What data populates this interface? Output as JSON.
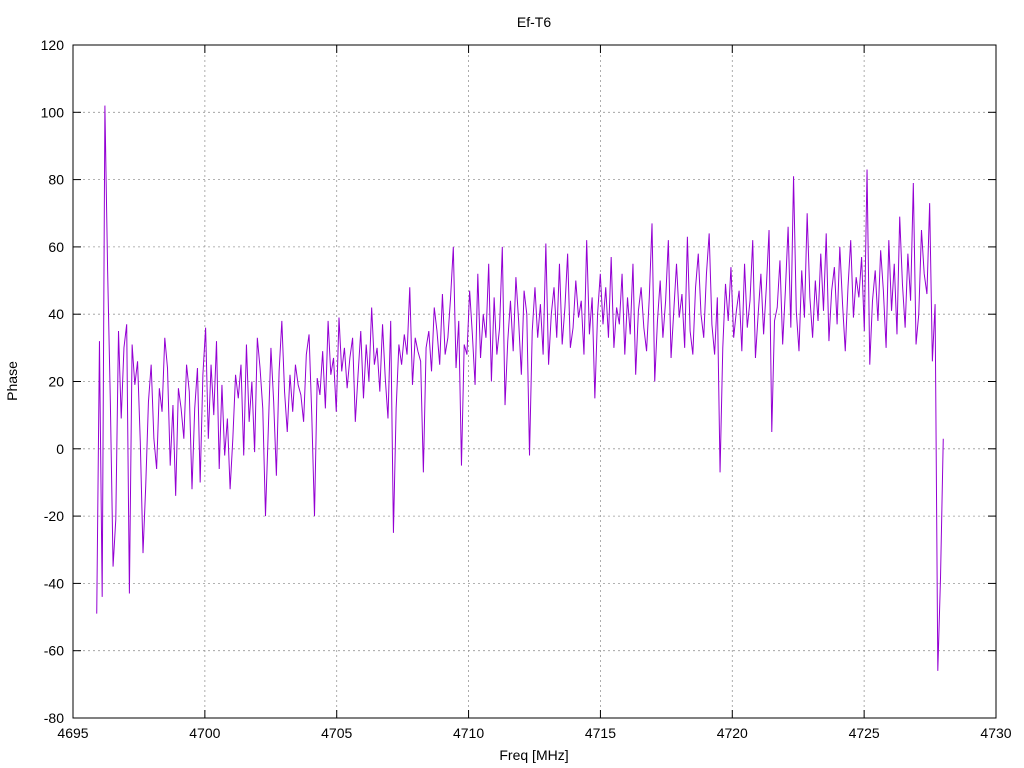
{
  "chart_data": {
    "type": "line",
    "title": "Ef-T6",
    "xlabel": "Freq [MHz]",
    "ylabel": "Phase",
    "xlim": [
      4695,
      4730
    ],
    "ylim": [
      -80,
      120
    ],
    "xticks": [
      4695,
      4700,
      4705,
      4710,
      4715,
      4720,
      4725,
      4730
    ],
    "yticks": [
      -80,
      -60,
      -40,
      -20,
      0,
      20,
      40,
      60,
      80,
      100,
      120
    ],
    "xtick_labels": [
      "4695",
      "4700",
      "4705",
      "4710",
      "4715",
      "4720",
      "4725",
      "4730"
    ],
    "ytick_labels": [
      "-80",
      "-60",
      "-40",
      "-20",
      "0",
      "20",
      "40",
      "60",
      "80",
      "100",
      "120"
    ],
    "grid": true,
    "line_color": "#9400d3",
    "series": [
      {
        "x_start": 4695.9,
        "x_end": 4728.0,
        "values": [
          -49,
          32,
          -44,
          102,
          53,
          14,
          -35,
          -21,
          35,
          9,
          30,
          37,
          -43,
          31,
          19,
          26,
          2,
          -31,
          -11,
          14,
          25,
          3,
          -6,
          18,
          11,
          33,
          24,
          -5,
          13,
          -14,
          18,
          12,
          3,
          25,
          17,
          -12,
          12,
          24,
          -10,
          22,
          36,
          3,
          25,
          10,
          32,
          -6,
          19,
          -2,
          9,
          -12,
          3,
          22,
          15,
          25,
          -2,
          31,
          8,
          20,
          -1,
          33,
          24,
          12,
          -20,
          5,
          30,
          14,
          -8,
          23,
          38,
          17,
          5,
          22,
          11,
          25,
          19,
          16,
          8,
          28,
          34,
          10,
          -20,
          21,
          16,
          29,
          12,
          38,
          22,
          27,
          11,
          39,
          23,
          30,
          18,
          27,
          33,
          8,
          22,
          35,
          15,
          31,
          20,
          42,
          25,
          30,
          17,
          37,
          21,
          9,
          38,
          -25,
          12,
          31,
          25,
          34,
          28,
          48,
          19,
          33,
          29,
          26,
          -7,
          30,
          35,
          23,
          42,
          35,
          25,
          46,
          28,
          33,
          45,
          60,
          24,
          38,
          -5,
          31,
          28,
          47,
          34,
          19,
          52,
          27,
          40,
          33,
          55,
          20,
          45,
          28,
          36,
          60,
          13,
          32,
          44,
          29,
          51,
          38,
          22,
          47,
          40,
          -2,
          35,
          48,
          33,
          43,
          28,
          61,
          25,
          40,
          48,
          33,
          55,
          31,
          42,
          58,
          30,
          36,
          50,
          39,
          44,
          28,
          62,
          34,
          45,
          15,
          40,
          52,
          37,
          48,
          33,
          57,
          30,
          42,
          37,
          52,
          28,
          45,
          34,
          55,
          22,
          41,
          48,
          36,
          29,
          45,
          67,
          20,
          38,
          50,
          33,
          44,
          62,
          27,
          41,
          55,
          39,
          46,
          30,
          63,
          35,
          28,
          48,
          58,
          40,
          33,
          52,
          64,
          37,
          28,
          45,
          -7,
          30,
          49,
          38,
          54,
          33,
          41,
          47,
          29,
          55,
          36,
          44,
          62,
          27,
          40,
          52,
          34,
          48,
          65,
          5,
          38,
          42,
          56,
          31,
          47,
          66,
          36,
          81,
          41,
          29,
          53,
          39,
          70,
          45,
          33,
          50,
          38,
          58,
          41,
          64,
          32,
          47,
          54,
          37,
          60,
          43,
          29,
          48,
          62,
          39,
          51,
          45,
          57,
          35,
          83,
          25,
          44,
          53,
          38,
          59,
          47,
          30,
          62,
          41,
          55,
          34,
          69,
          49,
          36,
          58,
          44,
          79,
          31,
          40,
          65,
          52,
          46,
          73,
          26,
          43,
          -66,
          -38,
          3
        ]
      }
    ]
  }
}
